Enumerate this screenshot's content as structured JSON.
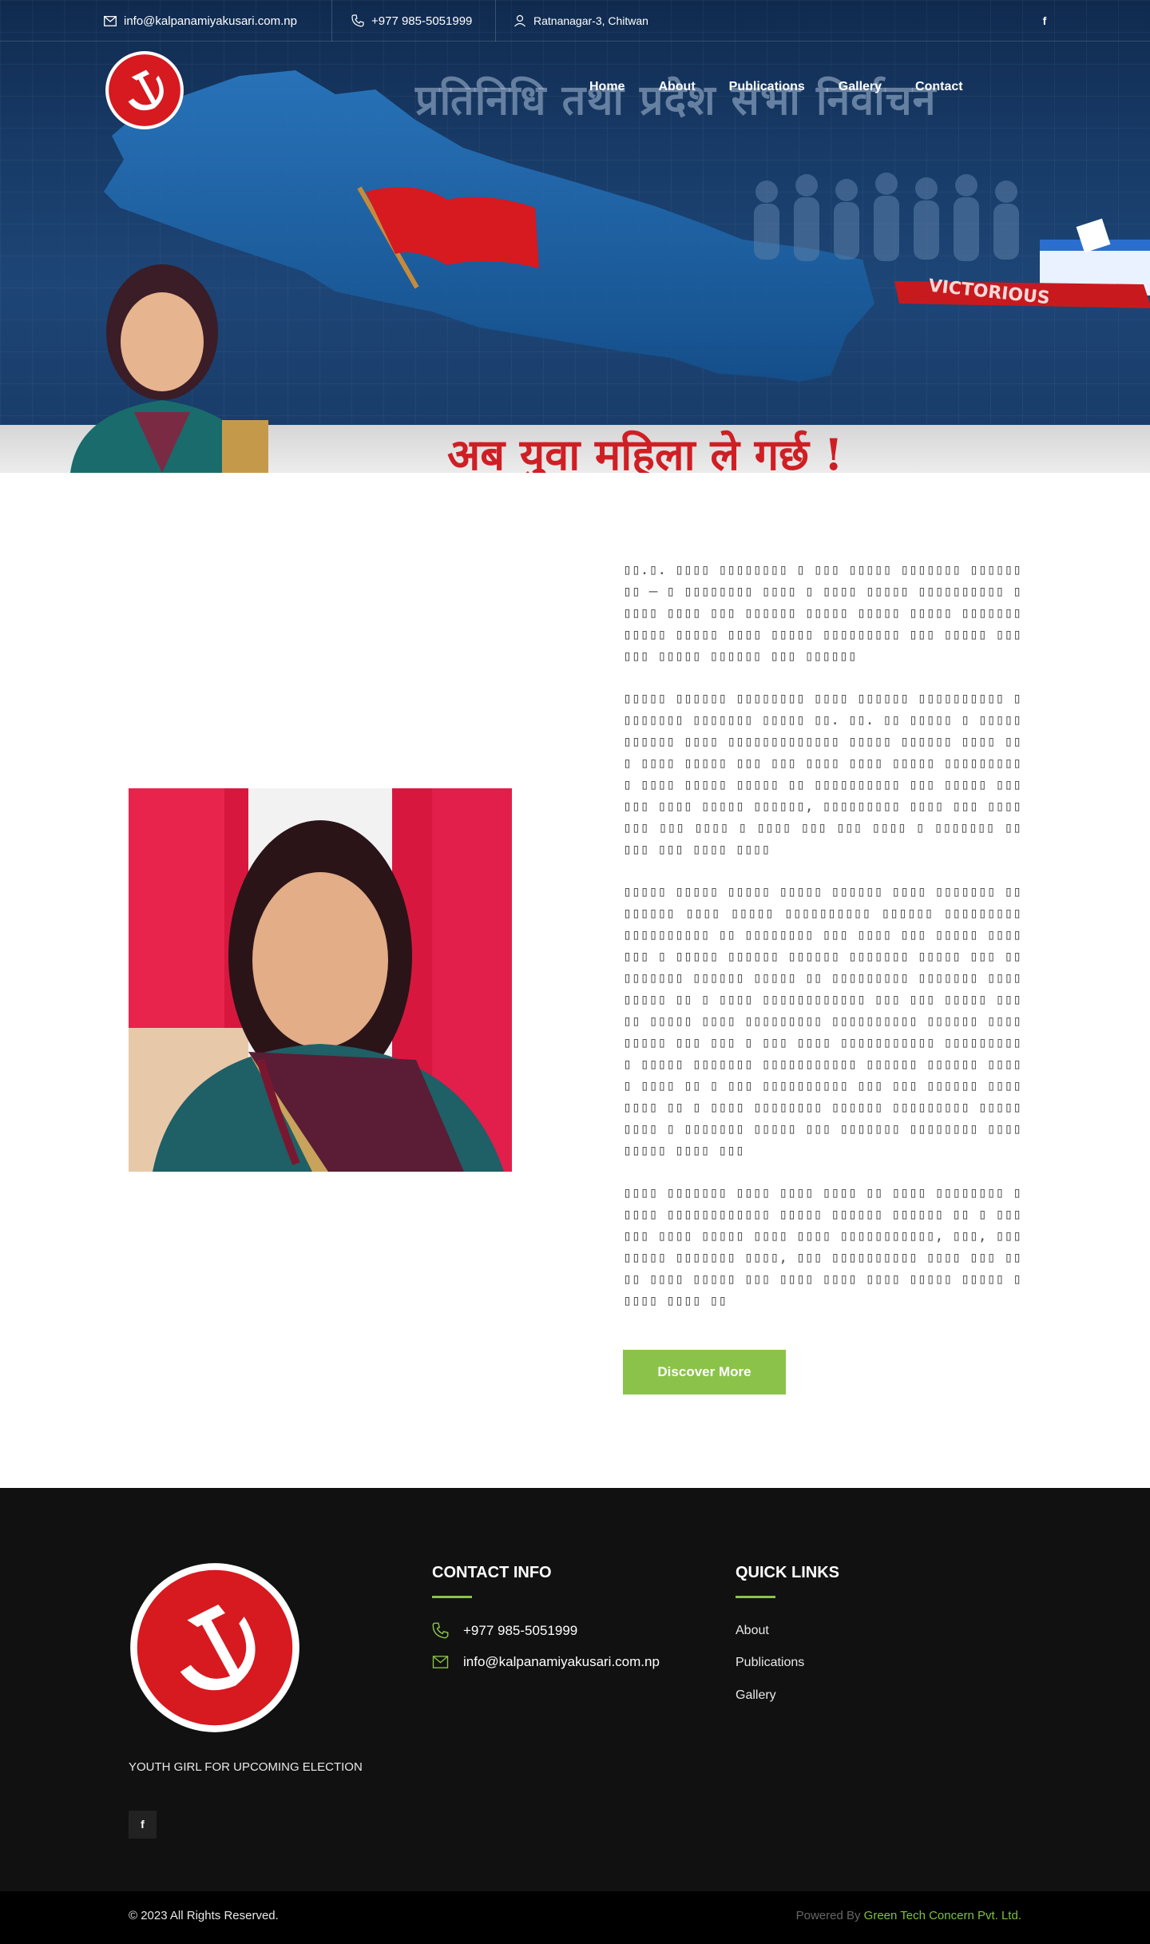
{
  "colors": {
    "accent": "#8bc34a",
    "party_red": "#d71920",
    "footer_bg": "#111111",
    "bottom_bg": "#000000",
    "hero_blue": "#173a66"
  },
  "topbar": {
    "email": "info@kalpanamiyakusari.com.np",
    "phone": "+977 985-5051999",
    "address": "Ratnanagar-3, Chitwan",
    "facebook_icon": "f"
  },
  "nav": {
    "items": [
      "Home",
      "About",
      "Publications",
      "Gallery",
      "Contact"
    ]
  },
  "hero": {
    "banner_title": "प्रतिनिधि तथा प्रदेश सभा निर्वाचन",
    "victorious": "VICTORIOUS",
    "slogan": "अब युवा महिला ले गर्छ !"
  },
  "about": {
    "paragraphs": [
      "  ▯▯.▯. ▯▯▯▯ ▯▯▯▯▯▯▯▯ ▯ ▯▯▯ ▯▯▯▯▯ ▯▯▯▯▯▯▯ ▯▯▯▯▯▯▯▯ – ▯ ▯▯▯▯▯▯▯▯ ▯▯▯▯ ▯ ▯▯▯▯ ▯▯▯▯▯ ▯▯▯▯▯▯▯▯▯▯ ▯▯▯▯▯ ▯▯▯▯ ▯▯▯ ▯▯▯▯▯▯ ▯▯▯▯▯ ▯▯▯▯▯ ▯▯▯▯▯ ▯▯▯▯▯▯▯ ▯▯▯▯▯ ▯▯▯▯▯ ▯▯▯▯ ▯▯▯▯▯ ▯▯▯▯▯▯▯▯▯ ▯▯▯ ▯▯▯▯▯ ▯▯▯▯▯▯ ▯▯▯▯▯ ▯▯▯▯▯▯ ▯▯▯ ▯▯▯▯▯▯",
      "▯▯▯▯▯ ▯▯▯▯▯▯ ▯▯▯▯▯▯▯▯ ▯▯▯▯ ▯▯▯▯▯▯ ▯▯▯▯▯▯▯▯▯▯ ▯▯▯▯▯▯▯▯ ▯▯▯▯▯▯▯ ▯▯▯▯▯ ▯▯. ▯▯. ▯▯ ▯▯▯▯▯ ▯ ▯▯▯▯▯ ▯▯▯▯▯▯ ▯▯▯▯ ▯▯▯▯▯▯▯▯▯▯▯▯▯ ▯▯▯▯▯ ▯▯▯▯▯▯ ▯▯▯▯ ▯▯▯ ▯▯▯▯ ▯▯▯▯▯ ▯▯▯ ▯▯▯ ▯▯▯▯ ▯▯▯▯ ▯▯▯▯▯ ▯▯▯▯▯▯▯▯▯▯ ▯▯▯▯ ▯▯▯▯▯ ▯▯▯▯▯ ▯▯ ▯▯▯▯▯▯▯▯▯▯ ▯▯▯ ▯▯▯▯▯ ▯▯▯▯▯▯ ▯▯▯▯ ▯▯▯▯▯ ▯▯▯▯▯▯, ▯▯▯▯▯▯▯▯▯ ▯▯▯▯ ▯▯▯ ▯▯▯▯▯▯▯ ▯▯▯ ▯▯▯▯ ▯ ▯▯▯▯ ▯▯▯ ▯▯▯ ▯▯▯▯ ▯ ▯▯▯▯▯▯▯ ▯▯ ▯▯▯ ▯▯▯ ▯▯▯▯ ▯▯▯▯",
      "▯▯▯▯▯ ▯▯▯▯▯ ▯▯▯▯▯ ▯▯▯▯▯ ▯▯▯▯▯▯ ▯▯▯▯ ▯▯▯▯▯▯▯ ▯▯▯▯▯▯▯▯ ▯▯▯▯ ▯▯▯▯▯ ▯▯▯▯▯▯▯▯▯▯ ▯▯▯▯▯▯ ▯▯▯▯▯▯▯▯▯ ▯▯▯▯▯▯▯▯▯▯ ▯▯ ▯▯▯▯▯▯▯▯ ▯▯▯ ▯▯▯▯ ▯▯▯ ▯▯▯▯▯ ▯▯▯▯ ▯▯▯ ▯ ▯▯▯▯▯ ▯▯▯▯▯▯ ▯▯▯▯▯▯ ▯▯▯▯▯▯▯ ▯▯▯▯▯ ▯▯▯ ▯▯▯▯▯▯▯▯▯ ▯▯▯▯▯▯ ▯▯▯▯▯ ▯▯ ▯▯▯▯▯▯▯▯▯ ▯▯▯▯▯▯▯ ▯▯▯▯▯▯▯▯▯ ▯▯  ▯ ▯▯▯▯ ▯▯▯▯▯▯▯▯▯▯▯▯ ▯▯▯ ▯▯▯ ▯▯▯▯▯ ▯▯▯▯▯ ▯▯▯▯▯ ▯▯▯▯ ▯▯▯▯▯▯▯▯▯ ▯▯▯▯▯▯▯▯▯▯ ▯▯▯▯▯▯ ▯▯▯▯▯▯▯▯▯ ▯▯▯ ▯▯▯ ▯ ▯▯▯ ▯▯▯▯ ▯▯▯▯▯▯▯▯▯▯▯ ▯▯▯▯▯▯▯▯▯ ▯ ▯▯▯▯▯ ▯▯▯▯▯▯▯ ▯▯▯▯▯▯▯▯▯▯▯ ▯▯▯▯▯▯ ▯▯▯▯▯▯ ▯▯▯▯▯ ▯▯▯▯ ▯▯ ▯ ▯▯▯ ▯▯▯▯▯▯▯▯▯▯ ▯▯▯ ▯▯▯ ▯▯▯▯▯▯ ▯▯▯▯ ▯▯▯▯ ▯▯ ▯ ▯▯▯▯ ▯▯▯▯▯▯▯▯ ▯▯▯▯▯▯ ▯▯▯▯▯▯▯▯▯ ▯▯▯▯▯▯▯▯▯ ▯ ▯▯▯▯▯▯▯ ▯▯▯▯▯ ▯▯▯ ▯▯▯▯▯▯▯ ▯▯▯▯▯▯▯▯ ▯▯▯▯ ▯▯▯▯▯ ▯▯▯▯ ▯▯▯",
      "▯▯▯▯ ▯▯▯▯▯▯▯ ▯▯▯▯ ▯▯▯▯ ▯▯▯▯ ▯▯ ▯▯▯▯ ▯▯▯▯▯▯▯▯ ▯▯▯▯▯ ▯▯▯▯▯▯▯▯▯▯▯▯ ▯▯▯▯▯ ▯▯▯▯▯▯ ▯▯▯▯▯▯ ▯▯ ▯ ▯▯▯▯▯▯ ▯▯▯▯ ▯▯▯▯▯ ▯▯▯▯ ▯▯▯▯ ▯▯▯▯▯▯▯▯▯▯▯, ▯▯▯, ▯▯▯▯▯▯▯▯ ▯▯▯▯▯▯▯ ▯▯▯▯, ▯▯▯ ▯▯▯▯▯▯▯▯▯▯ ▯▯▯▯ ▯▯▯ ▯▯▯▯ ▯▯▯▯ ▯▯▯▯▯ ▯▯▯ ▯▯▯▯ ▯▯▯▯ ▯▯▯▯ ▯▯▯▯▯ ▯▯▯▯▯ ▯▯▯▯▯ ▯▯▯▯ ▯▯"
    ],
    "button": "Discover More"
  },
  "footer": {
    "tagline": "YOUTH GIRL FOR UPCOMING ELECTION",
    "facebook_icon": "f",
    "contact": {
      "heading": "CONTACT INFO",
      "phone": "+977 985-5051999",
      "email": "info@kalpanamiyakusari.com.np"
    },
    "quick_links": {
      "heading": "QUICK LINKS",
      "items": [
        "About",
        "Publications",
        "Gallery"
      ]
    },
    "copyright": "© 2023 All Rights Reserved.",
    "powered_label": "Powered By",
    "powered_link": "Green Tech Concern Pvt. Ltd."
  }
}
